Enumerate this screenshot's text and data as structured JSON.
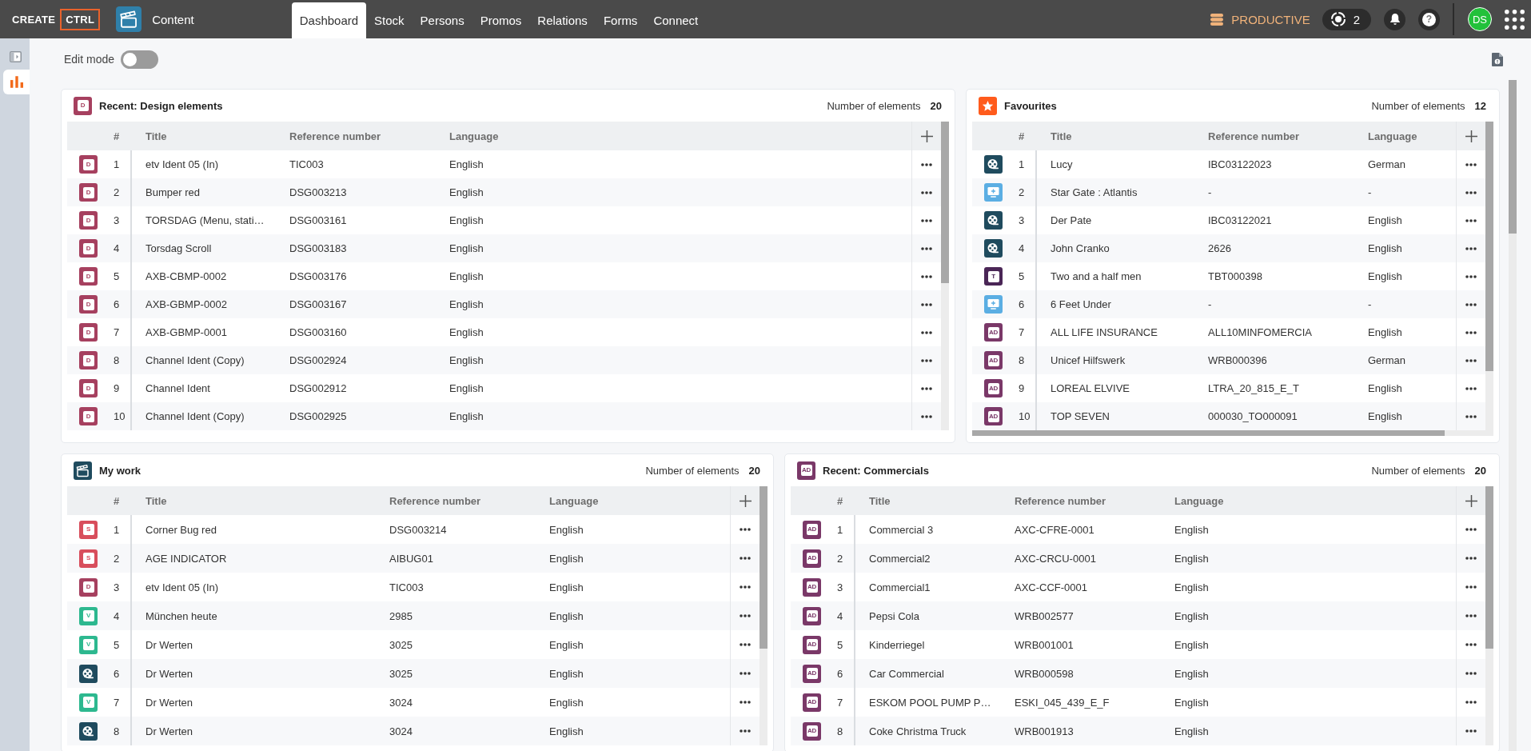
{
  "topbar": {
    "brand": "CREATE",
    "brand_boxed": "CTRL",
    "module": "Content",
    "tabs": [
      {
        "label": "Dashboard",
        "selected": true
      },
      {
        "label": "Stock",
        "selected": false
      },
      {
        "label": "Persons",
        "selected": false
      },
      {
        "label": "Promos",
        "selected": false
      },
      {
        "label": "Relations",
        "selected": false
      },
      {
        "label": "Forms",
        "selected": false
      },
      {
        "label": "Connect",
        "selected": false
      }
    ],
    "environment": "PRODUCTIVE",
    "task_count": "2",
    "help": "?",
    "avatar": "DS"
  },
  "sidebar": {
    "items": [
      {
        "kind": "dashboard",
        "selected": true
      }
    ]
  },
  "edit_mode": {
    "label": "Edit mode",
    "on": false
  },
  "panels": [
    {
      "title": "Recent: Design elements",
      "icon": {
        "kind": "design",
        "badge": "D"
      },
      "count_label": "Number of elements",
      "count": "20",
      "columns": [
        "#",
        "Title",
        "Reference number",
        "Language"
      ],
      "rows": [
        {
          "kind": "design",
          "badge": "D",
          "number": "1",
          "title": "etv Ident 05 (In)",
          "reference": "TIC003",
          "language": "English"
        },
        {
          "kind": "design",
          "badge": "D",
          "number": "2",
          "title": "Bumper red",
          "reference": "DSG003213",
          "language": "English"
        },
        {
          "kind": "design",
          "badge": "D",
          "number": "3",
          "title": "TORSDAG (Menu, stati…",
          "reference": "DSG003161",
          "language": "English"
        },
        {
          "kind": "design",
          "badge": "D",
          "number": "4",
          "title": "Torsdag Scroll",
          "reference": "DSG003183",
          "language": "English"
        },
        {
          "kind": "design",
          "badge": "D",
          "number": "5",
          "title": "AXB-CBMP-0002",
          "reference": "DSG003176",
          "language": "English"
        },
        {
          "kind": "design",
          "badge": "D",
          "number": "6",
          "title": "AXB-GBMP-0002",
          "reference": "DSG003167",
          "language": "English"
        },
        {
          "kind": "design",
          "badge": "D",
          "number": "7",
          "title": "AXB-GBMP-0001",
          "reference": "DSG003160",
          "language": "English"
        },
        {
          "kind": "design",
          "badge": "D",
          "number": "8",
          "title": "Channel Ident (Copy)",
          "reference": "DSG002924",
          "language": "English"
        },
        {
          "kind": "design",
          "badge": "D",
          "number": "9",
          "title": "Channel Ident",
          "reference": "DSG002912",
          "language": "English"
        },
        {
          "kind": "design",
          "badge": "D",
          "number": "10",
          "title": "Channel Ident (Copy)",
          "reference": "DSG002925",
          "language": "English"
        }
      ]
    },
    {
      "title": "Favourites",
      "icon": {
        "kind": "favourites"
      },
      "count_label": "Number of elements",
      "count": "12",
      "columns": [
        "#",
        "Title",
        "Reference number",
        "Language"
      ],
      "rows": [
        {
          "kind": "film",
          "number": "1",
          "title": "Lucy",
          "reference": "IBC03122023",
          "language": "German"
        },
        {
          "kind": "broadcast",
          "number": "2",
          "title": "Star Gate : Atlantis",
          "reference": "-",
          "language": "-"
        },
        {
          "kind": "film",
          "number": "3",
          "title": "Der Pate",
          "reference": "IBC03122021",
          "language": "English"
        },
        {
          "kind": "film",
          "number": "4",
          "title": "John Cranko",
          "reference": "2626",
          "language": "English"
        },
        {
          "kind": "title",
          "badge": "T",
          "number": "5",
          "title": "Two and a half men",
          "reference": "TBT000398",
          "language": "English"
        },
        {
          "kind": "broadcast",
          "number": "6",
          "title": "6 Feet Under",
          "reference": "-",
          "language": "-"
        },
        {
          "kind": "commercial",
          "badge": "AD",
          "number": "7",
          "title": "ALL LIFE INSURANCE",
          "reference": "ALL10MINFOMERCIA",
          "language": "English"
        },
        {
          "kind": "commercial",
          "badge": "AD",
          "number": "8",
          "title": "Unicef Hilfswerk",
          "reference": "WRB000396",
          "language": "German"
        },
        {
          "kind": "commercial",
          "badge": "AD",
          "number": "9",
          "title": "LOREAL ELVIVE",
          "reference": "LTRA_20_815_E_T",
          "language": "English"
        },
        {
          "kind": "commercial",
          "badge": "AD",
          "number": "10",
          "title": "TOP SEVEN",
          "reference": "000030_TO000091",
          "language": "English"
        }
      ]
    },
    {
      "title": "My work",
      "icon": {
        "kind": "work"
      },
      "count_label": "Number of elements",
      "count": "20",
      "columns": [
        "#",
        "Title",
        "Reference number",
        "Language"
      ],
      "rows": [
        {
          "kind": "spot",
          "badge": "S",
          "number": "1",
          "title": "Corner Bug red",
          "reference": "DSG003214",
          "language": "English"
        },
        {
          "kind": "spot",
          "badge": "S",
          "number": "2",
          "title": "AGE INDICATOR",
          "reference": "AIBUG01",
          "language": "English"
        },
        {
          "kind": "design",
          "badge": "D",
          "number": "3",
          "title": "etv Ident 05 (In)",
          "reference": "TIC003",
          "language": "English"
        },
        {
          "kind": "video",
          "badge": "V",
          "number": "4",
          "title": "München heute",
          "reference": "2985",
          "language": "English"
        },
        {
          "kind": "video",
          "badge": "V",
          "number": "5",
          "title": "Dr Werten",
          "reference": "3025",
          "language": "English"
        },
        {
          "kind": "film",
          "number": "6",
          "title": "Dr Werten",
          "reference": "3025",
          "language": "English"
        },
        {
          "kind": "video",
          "badge": "V",
          "number": "7",
          "title": "Dr Werten",
          "reference": "3024",
          "language": "English"
        },
        {
          "kind": "film",
          "number": "8",
          "title": "Dr Werten",
          "reference": "3024",
          "language": "English"
        }
      ]
    },
    {
      "title": "Recent: Commercials",
      "icon": {
        "kind": "commercial",
        "badge": "AD"
      },
      "count_label": "Number of elements",
      "count": "20",
      "columns": [
        "#",
        "Title",
        "Reference number",
        "Language"
      ],
      "rows": [
        {
          "kind": "commercial",
          "badge": "AD",
          "number": "1",
          "title": "Commercial 3",
          "reference": "AXC-CFRE-0001",
          "language": "English"
        },
        {
          "kind": "commercial",
          "badge": "AD",
          "number": "2",
          "title": "Commercial2",
          "reference": "AXC-CRCU-0001",
          "language": "English"
        },
        {
          "kind": "commercial",
          "badge": "AD",
          "number": "3",
          "title": "Commercial1",
          "reference": "AXC-CCF-0001",
          "language": "English"
        },
        {
          "kind": "commercial",
          "badge": "AD",
          "number": "4",
          "title": "Pepsi Cola",
          "reference": "WRB002577",
          "language": "English"
        },
        {
          "kind": "commercial",
          "badge": "AD",
          "number": "5",
          "title": "Kinderriegel",
          "reference": "WRB001001",
          "language": "English"
        },
        {
          "kind": "commercial",
          "badge": "AD",
          "number": "6",
          "title": "Car Commercial",
          "reference": "WRB000598",
          "language": "English"
        },
        {
          "kind": "commercial",
          "badge": "AD",
          "number": "7",
          "title": "ESKOM POOL PUMP P…",
          "reference": "ESKI_045_439_E_F",
          "language": "English"
        },
        {
          "kind": "commercial",
          "badge": "AD",
          "number": "8",
          "title": "Coke Christma Truck",
          "reference": "WRB001913",
          "language": "English"
        }
      ]
    }
  ]
}
